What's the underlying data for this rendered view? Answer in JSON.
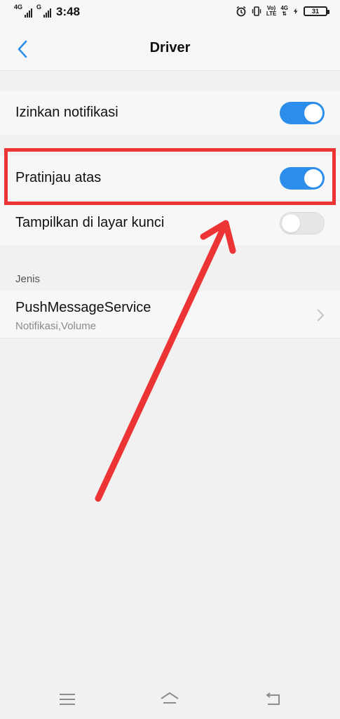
{
  "status_bar": {
    "network1": "4G",
    "network2": "G",
    "time": "3:48",
    "volte": "Vo)",
    "lte": "LTE",
    "network3": "4G",
    "battery_level": "31"
  },
  "header": {
    "title": "Driver"
  },
  "settings": [
    {
      "label": "Izinkan notifikasi",
      "enabled": true
    },
    {
      "label": "Pratinjau atas",
      "enabled": true
    },
    {
      "label": "Tampilkan di layar kunci",
      "enabled": false
    }
  ],
  "section": {
    "label": "Jenis"
  },
  "service": {
    "title": "PushMessageService",
    "subtitle": "Notifikasi,Volume"
  },
  "colors": {
    "accent": "#2c8eea",
    "annotation": "#ec3434"
  },
  "icons": [
    "back-icon",
    "chevron-right-icon",
    "menu-icon",
    "home-icon",
    "back-nav-icon",
    "alarm-icon",
    "vibrate-icon",
    "charging-icon"
  ]
}
